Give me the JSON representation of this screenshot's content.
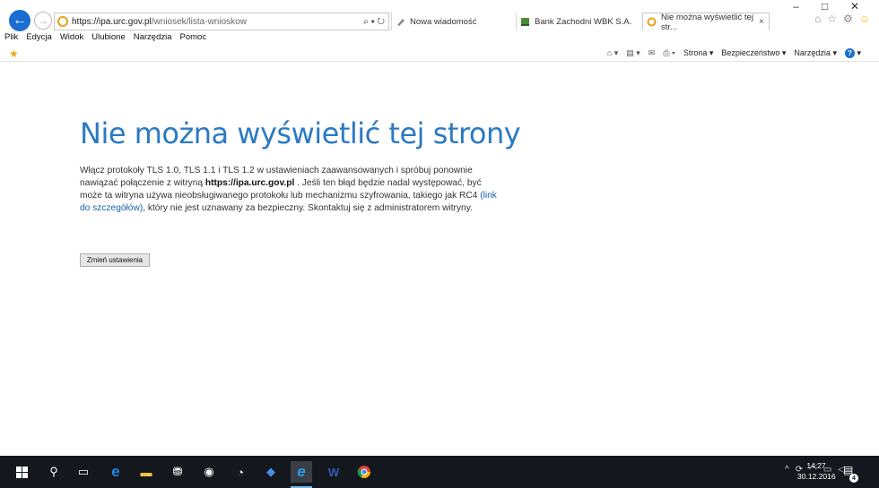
{
  "browser": {
    "address_host": "https://ipa.",
    "address_domain": "urc.gov.pl",
    "address_path": "/wniosek/lista-wnioskow",
    "address_tools": "⌕ ▾ ↻",
    "tabs": [
      {
        "label": "Nowa wiadomość",
        "icon": "mail-compose-icon"
      },
      {
        "label": "Bank Zachodni WBK S.A.",
        "icon": "bank-icon"
      },
      {
        "label": "Nie można wyświetlić tej str...",
        "icon": "loading-icon",
        "close": "×"
      }
    ],
    "window_controls": {
      "minimize": "–",
      "maximize": "□",
      "close": "✕"
    }
  },
  "menu": {
    "items": [
      "Plik",
      "Edycja",
      "Widok",
      "Ulubione",
      "Narzędzia",
      "Pomoc"
    ]
  },
  "command_bar": {
    "strona": "Strona ▾",
    "bezpieczenstwo": "Bezpieczeństwo ▾",
    "narzedzia": "Narzędzia ▾",
    "help": "?"
  },
  "error_page": {
    "title": "Nie można wyświetlić tej strony",
    "p1": "Włącz protokoły TLS 1.0, TLS 1.1 i TLS 1.2 w ustawieniach zaawansowanych i spróbuj ponownie nawiązać połączenie z witryną ",
    "site": "https://ipa.urc.gov.pl",
    "p2": " . Jeśli ten błąd będzie nadal występować, być może ta witryna używa nieobsługiwanego protokołu lub mechanizmu szyfrowania, takiego jak RC4 ",
    "link": "(link do szczegółów)",
    "p3": ", który nie jest uznawany za bezpieczny. Skontaktuj się z administratorem witryny.",
    "button": "Zmień ustawienia"
  },
  "taskbar": {
    "time": "14:27",
    "date": "30.12.2016",
    "notifications": "4"
  }
}
